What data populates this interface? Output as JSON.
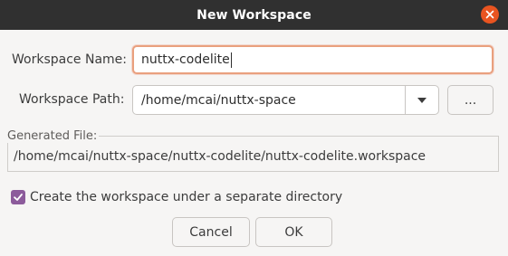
{
  "window": {
    "title": "New Workspace"
  },
  "form": {
    "name_label": "Workspace Name:",
    "name_value": "nuttx-codelite",
    "path_label": "Workspace Path:",
    "path_value": "/home/mcai/nuttx-space",
    "browse_label": "...",
    "generated_label": "Generated File:",
    "generated_value": "/home/mcai/nuttx-space/nuttx-codelite/nuttx-codelite.workspace",
    "separate_dir_label": "Create the workspace under a separate directory",
    "separate_dir_checked": true
  },
  "buttons": {
    "cancel_label": "Cancel",
    "ok_label": "OK"
  },
  "icons": {
    "close": "close-icon",
    "dropdown": "chevron-down-icon",
    "check": "checkmark-icon"
  },
  "colors": {
    "titlebar": "#303030",
    "close_button": "#e95420",
    "checkbox": "#8c5b9b",
    "focus_border": "#e9a07e"
  }
}
